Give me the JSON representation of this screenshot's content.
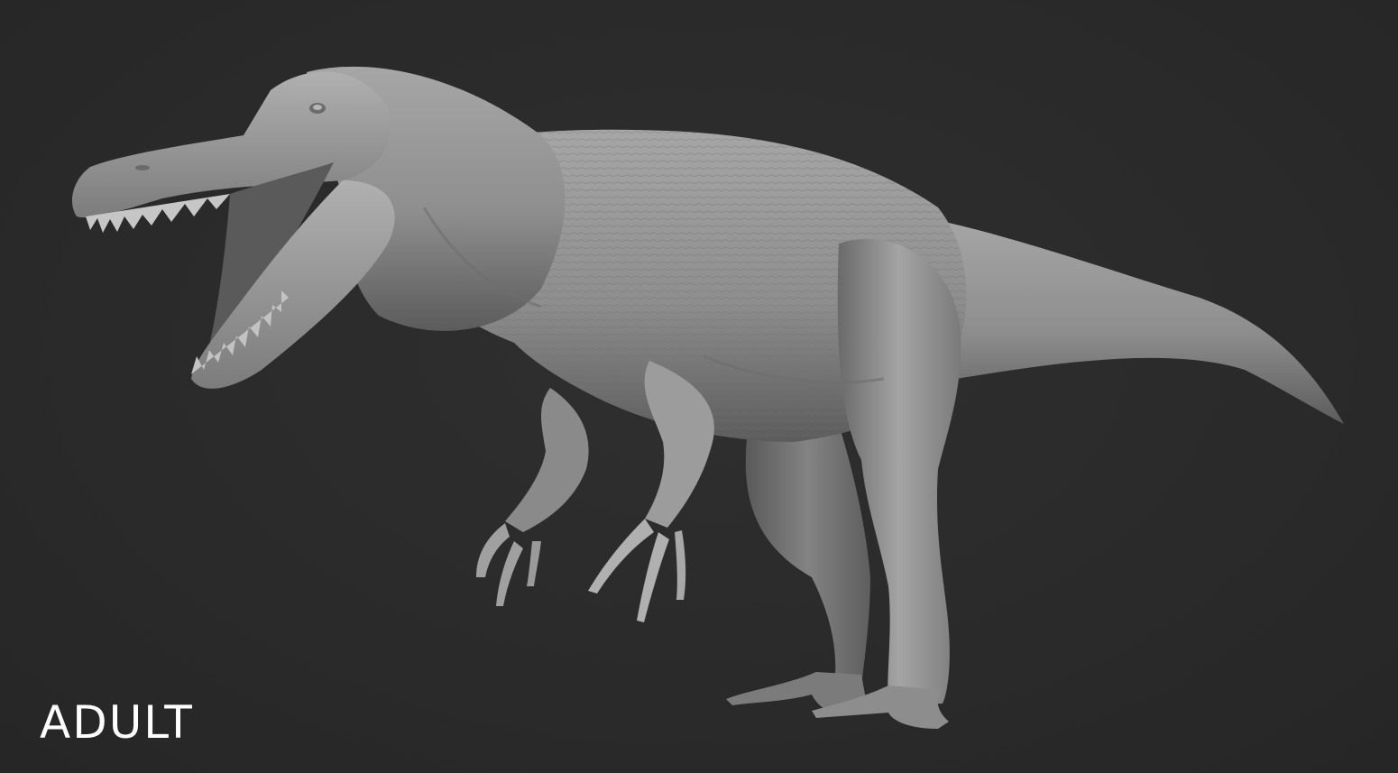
{
  "viewport": {
    "background_color": "#2b2b2b",
    "model_color": "#8f8f8f"
  },
  "label": {
    "text": "ADULT",
    "color": "#ffffff"
  }
}
